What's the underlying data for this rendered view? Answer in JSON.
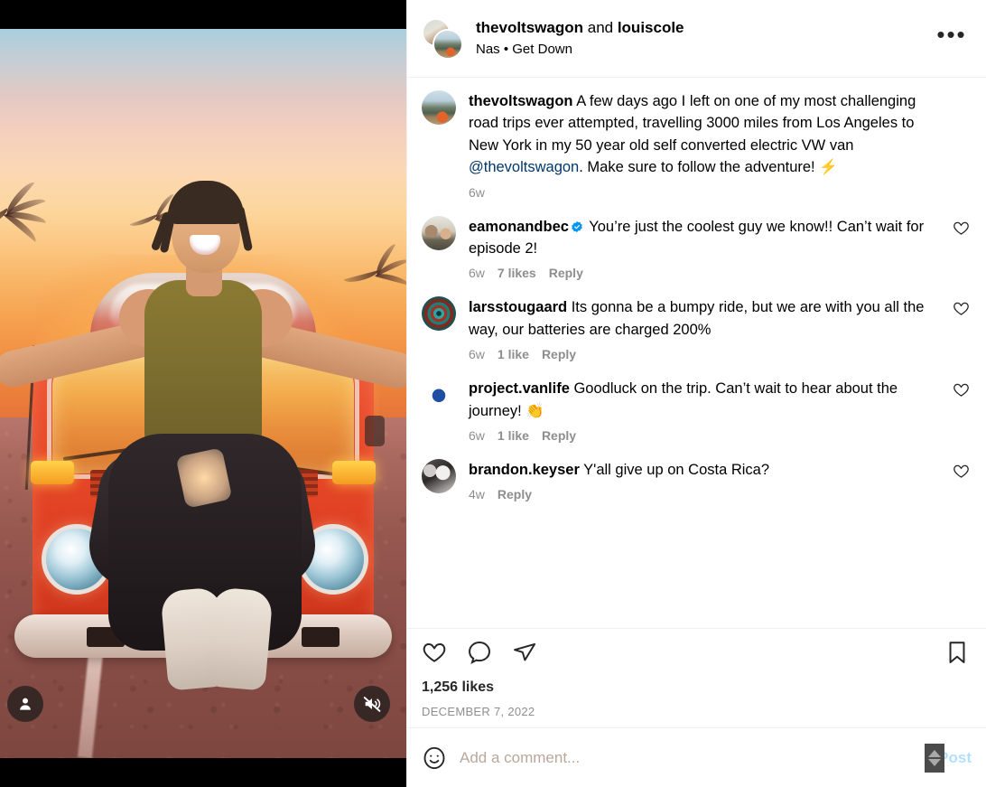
{
  "post": {
    "header": {
      "username_primary": "thevoltswagon",
      "conjunction": " and ",
      "username_secondary": "louiscole",
      "audio_label": "Nas • Get Down",
      "more_icon": "more-options-icon",
      "more_glyph": "•••"
    },
    "media": {
      "tag_icon": "person-tag-icon",
      "mute_icon": "sound-muted-icon"
    },
    "caption": {
      "username": "thevoltswagon",
      "text_before_mention": " A few days ago I left on one of my most challenging road trips ever attempted, travelling 3000 miles from Los Angeles to New York in my 50 year old self converted electric VW van ",
      "mention": "@thevoltswagon",
      "text_after_mention": ". Make sure to follow the adventure! ",
      "emoji": "⚡",
      "timestamp": "6w"
    },
    "comments": [
      {
        "username": "eamonandbec",
        "verified": true,
        "text": " You’re just the coolest guy we know!! Can’t wait for episode 2!",
        "timestamp": "6w",
        "likes": "7 likes",
        "reply": "Reply",
        "avatar": "img-couple",
        "like_icon": "heart-outline-icon"
      },
      {
        "username": "larsstougaard",
        "verified": false,
        "text": " Its gonna be a bumpy ride, but we are with you all the way, our batteries are charged 200%",
        "timestamp": "6w",
        "likes": "1 like",
        "reply": "Reply",
        "avatar": "img-mandala",
        "like_icon": "heart-outline-icon"
      },
      {
        "username": "project.vanlife",
        "verified": false,
        "text": " Goodluck on the trip. Can’t wait to hear about the journey! 👏",
        "timestamp": "6w",
        "likes": "1 like",
        "reply": "Reply",
        "avatar": "img-vanlife",
        "like_icon": "heart-outline-icon"
      },
      {
        "username": "brandon.keyser",
        "verified": false,
        "text": " Y'all give up on Costa Rica?",
        "timestamp": "4w",
        "likes": "",
        "reply": "Reply",
        "avatar": "img-bw-baby",
        "like_icon": "heart-outline-icon"
      }
    ],
    "actions": {
      "like_icon": "heart-outline-icon",
      "comment_icon": "comment-bubble-icon",
      "share_icon": "share-paper-plane-icon",
      "save_icon": "bookmark-outline-icon",
      "likes_count": "1,256 likes",
      "post_date": "DECEMBER 7, 2022"
    },
    "composer": {
      "emoji_icon": "emoji-smiley-icon",
      "placeholder": "Add a comment...",
      "value": "",
      "post_label": "Post",
      "scrollbar_icon": "scroll-thumb-arrows"
    }
  },
  "colors": {
    "accent_link": "#00376b",
    "verified_blue": "#0095f6",
    "post_button": "#b2dffc",
    "muted_text": "#8e8e8e",
    "primary_text": "#262626",
    "border": "#efefef"
  }
}
